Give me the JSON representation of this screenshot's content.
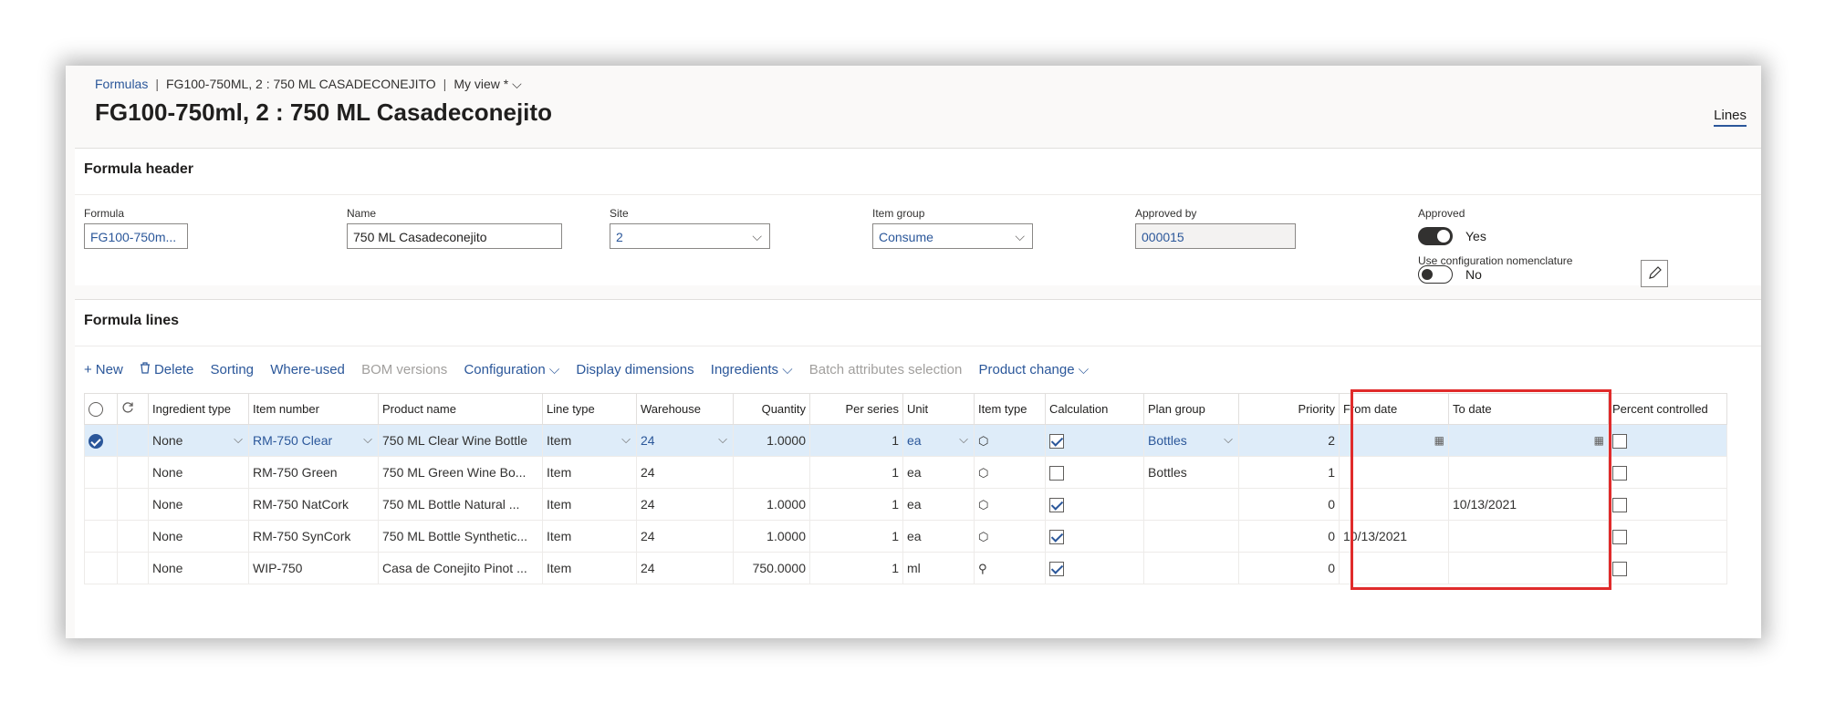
{
  "breadcrumb": {
    "items": [
      "Formulas",
      "FG100-750ML, 2 : 750 ML CASADECONEJITO",
      "My view *"
    ],
    "separator": "|",
    "caret": "⌵"
  },
  "page_title": "FG100-750ml, 2 : 750 ML Casadeconejito",
  "lines_link": "Lines",
  "formula_header": {
    "title": "Formula header",
    "fields": {
      "formula": {
        "label": "Formula",
        "value": "FG100-750m..."
      },
      "name": {
        "label": "Name",
        "value": "750 ML Casadeconejito"
      },
      "site": {
        "label": "Site",
        "value": "2"
      },
      "item_group": {
        "label": "Item group",
        "value": "Consume"
      },
      "approved_by": {
        "label": "Approved by",
        "value": "000015"
      },
      "approved": {
        "label": "Approved",
        "value": "Yes"
      },
      "use_config": {
        "label": "Use configuration nomenclature",
        "value": "No"
      }
    }
  },
  "formula_lines": {
    "title": "Formula lines",
    "toolbar": {
      "new": "New",
      "delete": "Delete",
      "sorting": "Sorting",
      "where_used": "Where-used",
      "bom_versions": "BOM versions",
      "configuration": "Configuration",
      "display_dimensions": "Display dimensions",
      "ingredients": "Ingredients",
      "batch_attributes": "Batch attributes selection",
      "product_change": "Product change"
    },
    "columns": {
      "ingredient_type": "Ingredient type",
      "item_number": "Item number",
      "product_name": "Product name",
      "line_type": "Line type",
      "warehouse": "Warehouse",
      "quantity": "Quantity",
      "per_series": "Per series",
      "unit": "Unit",
      "item_type": "Item type",
      "calculation": "Calculation",
      "plan_group": "Plan group",
      "priority": "Priority",
      "from_date": "From date",
      "to_date": "To date",
      "percent_controlled": "Percent controlled"
    },
    "rows": [
      {
        "ingredient_type": "None",
        "item_number": "RM-750 Clear",
        "product_name": "750 ML Clear Wine Bottle",
        "line_type": "Item",
        "warehouse": "24",
        "quantity": "1.0000",
        "per_series": "1",
        "unit": "ea",
        "item_type_icon": "cube-icon",
        "calculation": true,
        "plan_group": "Bottles",
        "priority": "2",
        "from_date": "",
        "to_date": "",
        "percent_controlled": false,
        "selected": true
      },
      {
        "ingredient_type": "None",
        "item_number": "RM-750 Green",
        "product_name": "750 ML Green Wine Bo...",
        "line_type": "Item",
        "warehouse": "24",
        "quantity": "",
        "per_series": "1",
        "unit": "ea",
        "item_type_icon": "cube-icon",
        "calculation": false,
        "plan_group": "Bottles",
        "priority": "1",
        "from_date": "",
        "to_date": "",
        "percent_controlled": false,
        "selected": false
      },
      {
        "ingredient_type": "None",
        "item_number": "RM-750 NatCork",
        "product_name": "750 ML Bottle Natural ...",
        "line_type": "Item",
        "warehouse": "24",
        "quantity": "1.0000",
        "per_series": "1",
        "unit": "ea",
        "item_type_icon": "cube-icon",
        "calculation": true,
        "plan_group": "",
        "priority": "0",
        "from_date": "",
        "to_date": "10/13/2021",
        "percent_controlled": false,
        "selected": false
      },
      {
        "ingredient_type": "None",
        "item_number": "RM-750 SynCork",
        "product_name": "750 ML Bottle Synthetic...",
        "line_type": "Item",
        "warehouse": "24",
        "quantity": "1.0000",
        "per_series": "1",
        "unit": "ea",
        "item_type_icon": "cube-icon",
        "calculation": true,
        "plan_group": "",
        "priority": "0",
        "from_date": "10/13/2021",
        "to_date": "",
        "percent_controlled": false,
        "selected": false
      },
      {
        "ingredient_type": "None",
        "item_number": "WIP-750",
        "product_name": "Casa de Conejito Pinot ...",
        "line_type": "Item",
        "warehouse": "24",
        "quantity": "750.0000",
        "per_series": "1",
        "unit": "ml",
        "item_type_icon": "hierarchy-icon",
        "calculation": true,
        "plan_group": "",
        "priority": "0",
        "from_date": "",
        "to_date": "",
        "percent_controlled": false,
        "selected": false
      }
    ]
  },
  "colors": {
    "accent": "#2b579a",
    "selected_row": "#deecf9",
    "highlight": "#e02b2b"
  }
}
